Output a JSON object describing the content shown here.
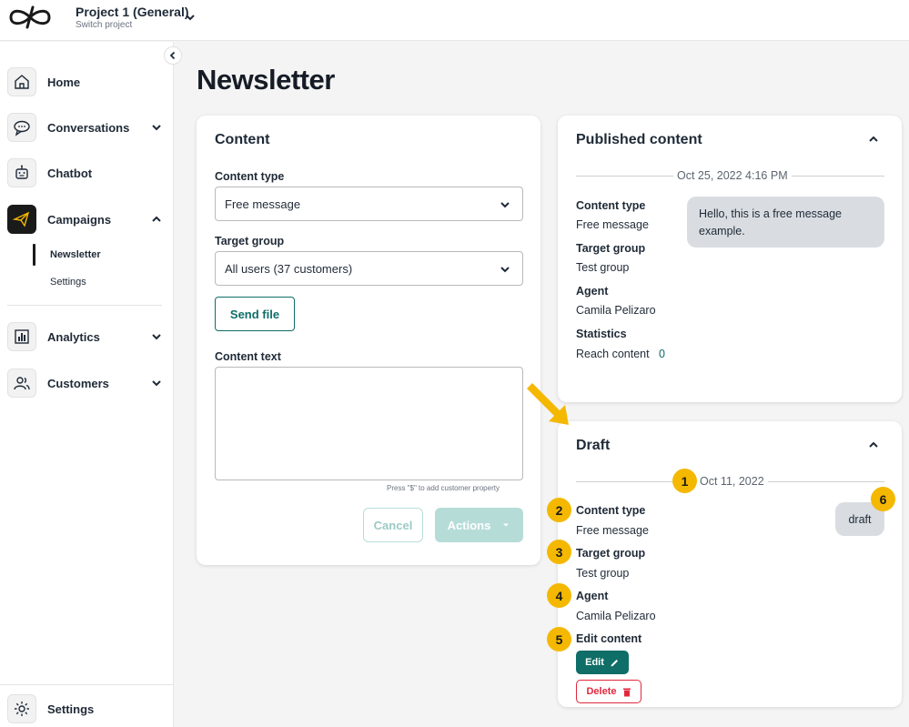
{
  "header": {
    "project_title": "Project 1 (General)",
    "project_subtitle": "Switch project"
  },
  "sidebar": {
    "items": [
      {
        "label": "Home",
        "icon": "home-icon"
      },
      {
        "label": "Conversations",
        "icon": "chat-icon"
      },
      {
        "label": "Chatbot",
        "icon": "robot-icon"
      },
      {
        "label": "Campaigns",
        "icon": "megaphone-icon"
      },
      {
        "label": "Analytics",
        "icon": "chart-icon"
      },
      {
        "label": "Customers",
        "icon": "users-icon"
      }
    ],
    "campaign_subitems": [
      "Newsletter",
      "Settings"
    ],
    "settings_label": "Settings"
  },
  "page": {
    "title": "Newsletter"
  },
  "content_card": {
    "title": "Content",
    "content_type_label": "Content type",
    "content_type_value": "Free message",
    "target_group_label": "Target group",
    "target_group_value": "All users (37 customers)",
    "send_file_label": "Send file",
    "content_text_label": "Content text",
    "hint": "Press \"$\" to add customer property",
    "cancel_label": "Cancel",
    "actions_label": "Actions"
  },
  "published_card": {
    "title": "Published content",
    "date": "Oct 25, 2022 4:16 PM",
    "content_type_label": "Content type",
    "content_type_value": "Free message",
    "target_group_label": "Target group",
    "target_group_value": "Test group",
    "agent_label": "Agent",
    "agent_value": "Camila Pelizaro",
    "statistics_label": "Statistics",
    "reach_label": "Reach content",
    "reach_value": "0",
    "message_bubble": "Hello, this is a free message example."
  },
  "draft_card": {
    "title": "Draft",
    "date": "Oct 11, 2022",
    "content_type_label": "Content type",
    "content_type_value": "Free message",
    "target_group_label": "Target group",
    "target_group_value": "Test group",
    "agent_label": "Agent",
    "agent_value": "Camila Pelizaro",
    "edit_content_label": "Edit content",
    "edit_label": "Edit",
    "delete_label": "Delete",
    "status_pill": "draft"
  },
  "annotations": [
    "1",
    "2",
    "3",
    "4",
    "5",
    "6"
  ],
  "colors": {
    "accent": "#0f6e67",
    "danger": "#e0283d",
    "badge": "#f5b800",
    "arrow": "#f5b800"
  }
}
